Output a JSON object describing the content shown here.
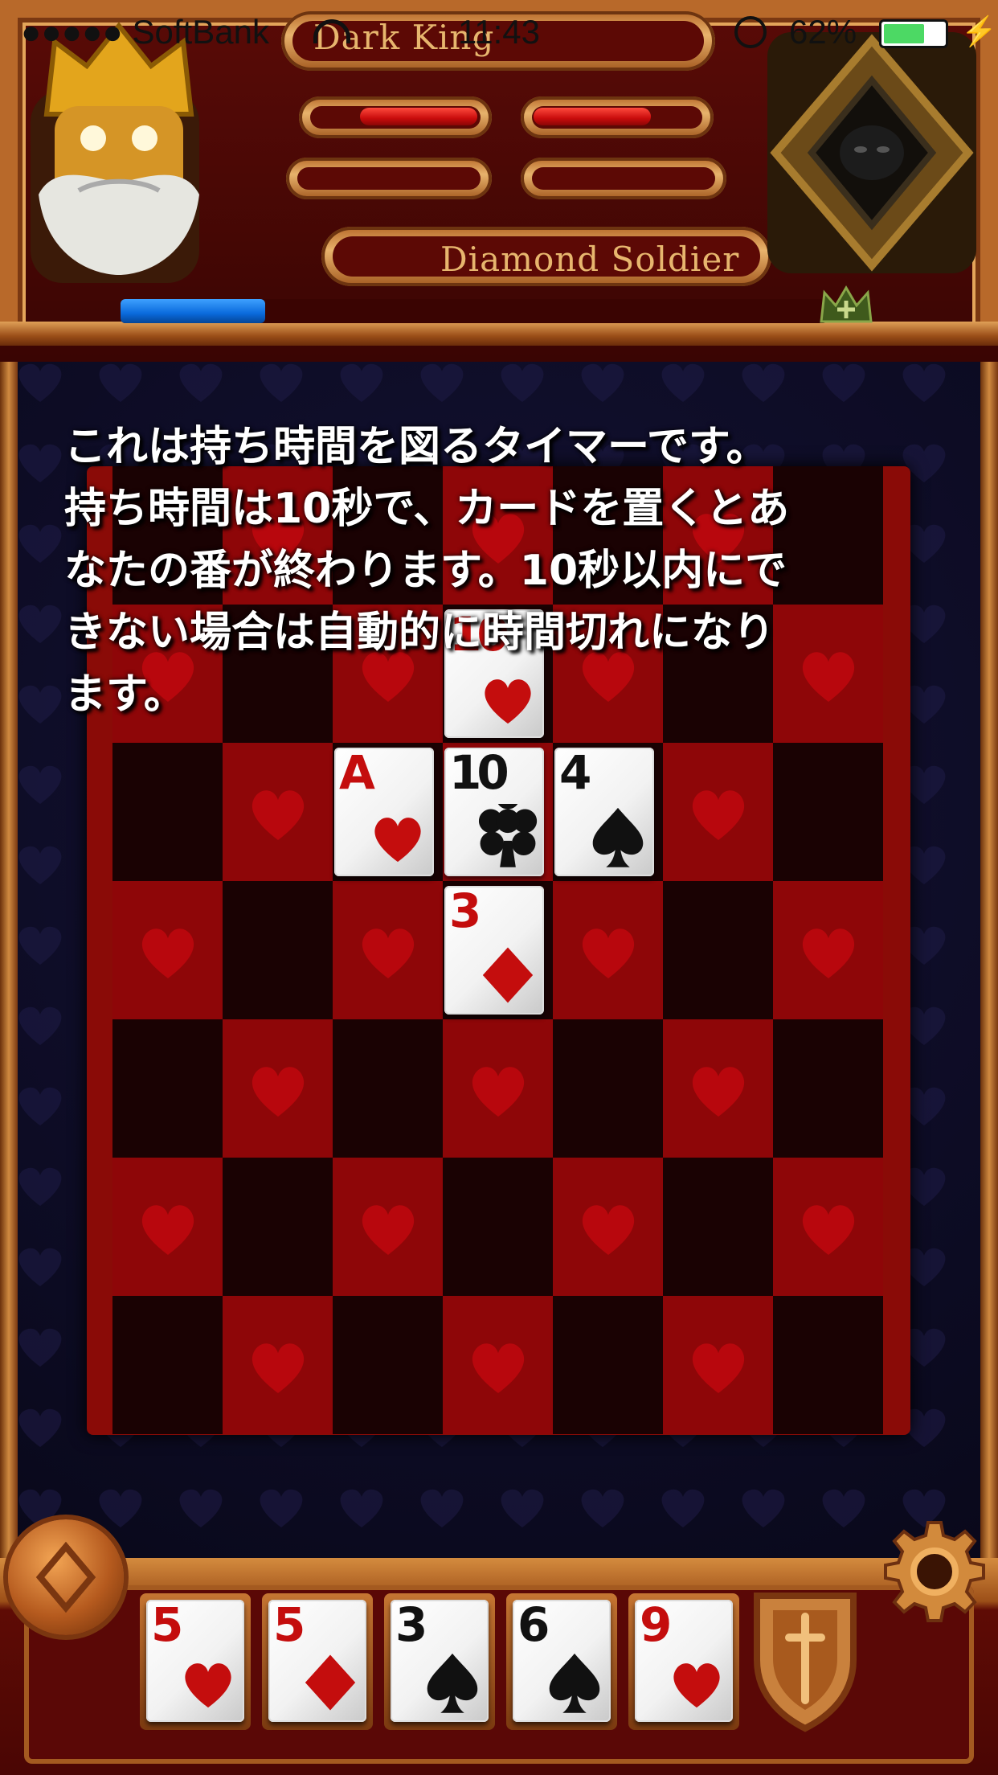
{
  "status_bar": {
    "carrier": "●●●●● SoftBank",
    "time": "11:43",
    "battery": "62%"
  },
  "header": {
    "player_name": "Dark King",
    "opponent_name": "Diamond Soldier",
    "player_hp": 1.0,
    "opponent_hp": 1.0,
    "xp_progress": 0.2
  },
  "tutorial_text": "これは持ち時間を図るタイマーです。\n持ち時間は10秒で、カードを置くとあ\nなたの番が終わります。10秒以内にで\nきない場合は自動的に時間切れになり\nます。",
  "board": {
    "cards": [
      {
        "rank": "10",
        "suit": "hearts",
        "color": "red"
      },
      {
        "rank": "A",
        "suit": "hearts",
        "color": "red"
      },
      {
        "rank": "10",
        "suit": "clubs",
        "color": "black"
      },
      {
        "rank": "4",
        "suit": "spades",
        "color": "black"
      },
      {
        "rank": "3",
        "suit": "diamonds",
        "color": "red"
      }
    ]
  },
  "hand": [
    {
      "rank": "5",
      "suit": "hearts",
      "color": "red"
    },
    {
      "rank": "5",
      "suit": "diamonds",
      "color": "red"
    },
    {
      "rank": "3",
      "suit": "spades",
      "color": "black"
    },
    {
      "rank": "6",
      "suit": "spades",
      "color": "black"
    },
    {
      "rank": "9",
      "suit": "hearts",
      "color": "red"
    }
  ],
  "icons": {
    "left_button": "card-deck-icon",
    "right_button": "gear-icon",
    "shield": "sword-shield-icon",
    "crown": "crown-plus-icon"
  },
  "colors": {
    "hp": "#d61212",
    "xp": "#1f7de0",
    "board_red": "#8e0608",
    "board_dark": "#1a0203",
    "frame_gold": "#c98138"
  }
}
